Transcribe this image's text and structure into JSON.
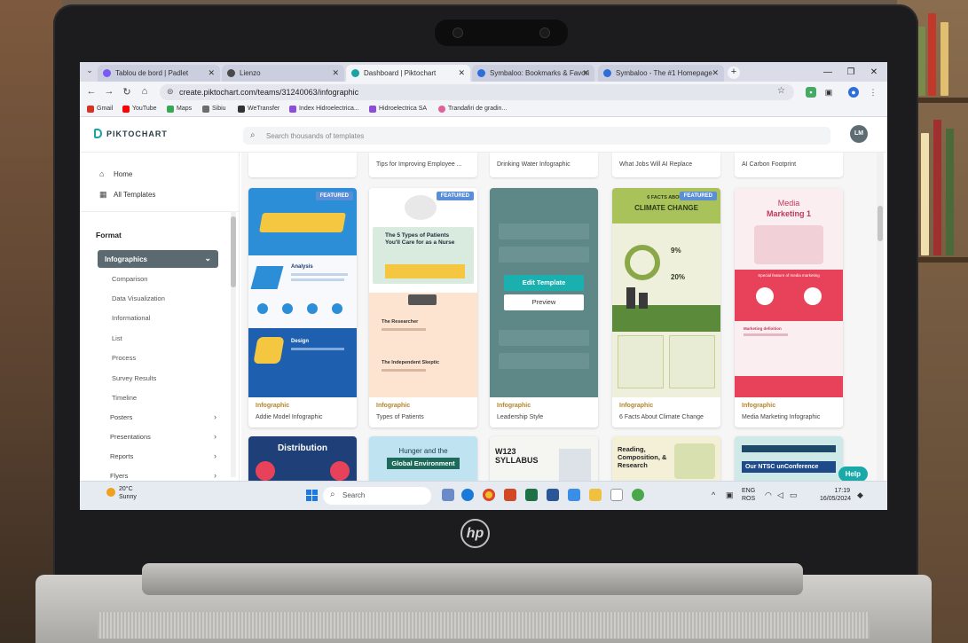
{
  "browser": {
    "tabs": [
      {
        "label": "Tablou de bord | Padlet",
        "icon_color": "#7a5af5"
      },
      {
        "label": "Lienzo",
        "icon_color": "#4a4a4a"
      },
      {
        "label": "Dashboard | Piktochart",
        "icon_color": "#1aa3a3"
      },
      {
        "label": "Symbaloo: Bookmarks & Favori",
        "icon_color": "#2d6fd8"
      },
      {
        "label": "Symbaloo - The #1 Homepage",
        "icon_color": "#2d6fd8"
      }
    ],
    "url": "create.piktochart.com/teams/31240063/infographic",
    "bookmarks": [
      {
        "label": "Gmail",
        "color": "#d93025"
      },
      {
        "label": "YouTube",
        "color": "#ff0000"
      },
      {
        "label": "Maps",
        "color": "#34a853"
      },
      {
        "label": "Sibiu",
        "color": "#6d6d6d"
      },
      {
        "label": "WeTransfer",
        "color": "#333333"
      },
      {
        "label": "Index Hidroelectrica...",
        "color": "#8a4fd6"
      },
      {
        "label": "Hidroelectrica SA",
        "color": "#8a4fd6"
      },
      {
        "label": "Trandafiri de gradin...",
        "color": "#e0609a"
      }
    ]
  },
  "app": {
    "logo_text": "PIKTOCHART",
    "search_placeholder": "Search thousands of templates",
    "avatar_initials": "LM",
    "accent": "#1aa3a3"
  },
  "sidebar": {
    "home": "Home",
    "all_templates": "All Templates",
    "format_label": "Format",
    "selected": "Infographics",
    "sub_items": [
      "Comparison",
      "Data Visualization",
      "Informational",
      "List",
      "Process",
      "Survey Results",
      "Timeline"
    ],
    "categories": [
      "Posters",
      "Presentations",
      "Reports",
      "Flyers"
    ]
  },
  "top_row": [
    "",
    "Tips for Improving Employee ...",
    "Drinking Water Infographic",
    "What Jobs Will AI Replace",
    "AI Carbon Footprint"
  ],
  "cards": [
    {
      "type": "Infographic",
      "name": "Addie Model Infographic",
      "badge": "FEATURED",
      "thumb_title_1": "Analysis",
      "thumb_title_2": "Design"
    },
    {
      "type": "Infographic",
      "name": "Types of Patients",
      "badge": "FEATURED",
      "thumb_title_1": "The 5 Types of Patients You'll Care for as a Nurse",
      "thumb_title_2": "The Researcher",
      "thumb_title_3": "The Independent Skeptic"
    },
    {
      "type": "Infographic",
      "name": "Leadership Style",
      "badge": "",
      "edit_label": "Edit Template",
      "preview_label": "Preview"
    },
    {
      "type": "Infographic",
      "name": "6 Facts About Climate Change",
      "badge": "FEATURED",
      "thumb_title_1": "6 FACTS ABOUT",
      "thumb_title_2": "CLIMATE CHANGE",
      "stat_1": "9%",
      "stat_2": "20%"
    },
    {
      "type": "Infographic",
      "name": "Media Marketing Infographic",
      "badge": "",
      "thumb_title_1": "Media",
      "thumb_title_2": "Marketing 1",
      "thumb_sub_1": "Special feature of media marketing",
      "thumb_sub_2": "Marketing definition"
    }
  ],
  "bottom_row": [
    {
      "title": "Distribution"
    },
    {
      "title": "Hunger and the",
      "title_2": "Global Environment"
    },
    {
      "title": "W123",
      "title_2": "SYLLABUS"
    },
    {
      "title": "Reading, Composition, & Research"
    },
    {
      "title": "Our NTSC unConference"
    }
  ],
  "help_label": "Help",
  "taskbar": {
    "temperature": "20°C",
    "weather": "Sunny",
    "search": "Search",
    "lang": "ENG",
    "region": "ROS",
    "time": "17:19",
    "date": "16/05/2024"
  },
  "device": {
    "brand": "hp"
  }
}
